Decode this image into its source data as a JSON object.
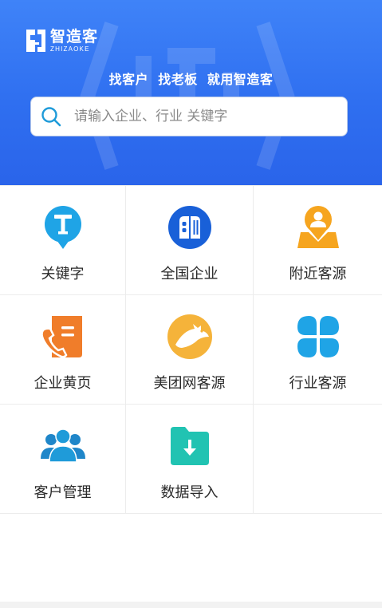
{
  "header": {
    "logo": {
      "cn": "智造客",
      "en": "ZHIZAOKE"
    },
    "slogan": "找客户  找老板  就用智造客",
    "search_placeholder": "请输入企业、行业 关键字"
  },
  "grid": {
    "items": [
      {
        "label": "关键字",
        "icon": "keyword-t-icon"
      },
      {
        "label": "全国企业",
        "icon": "building-icon"
      },
      {
        "label": "附近客源",
        "icon": "location-person-icon"
      },
      {
        "label": "企业黄页",
        "icon": "phone-doc-icon"
      },
      {
        "label": "美团网客源",
        "icon": "kangaroo-icon"
      },
      {
        "label": "行业客源",
        "icon": "clover-icon"
      },
      {
        "label": "客户管理",
        "icon": "people-icon"
      },
      {
        "label": "数据导入",
        "icon": "folder-import-icon"
      }
    ]
  },
  "colors": {
    "header": "#2f6ff0",
    "cyan": "#1fa4e6",
    "blue": "#1960d8",
    "orange": "#f6a51f",
    "orange_red": "#f07d2a",
    "amber": "#f5b33a",
    "teal": "#21c3b2"
  }
}
